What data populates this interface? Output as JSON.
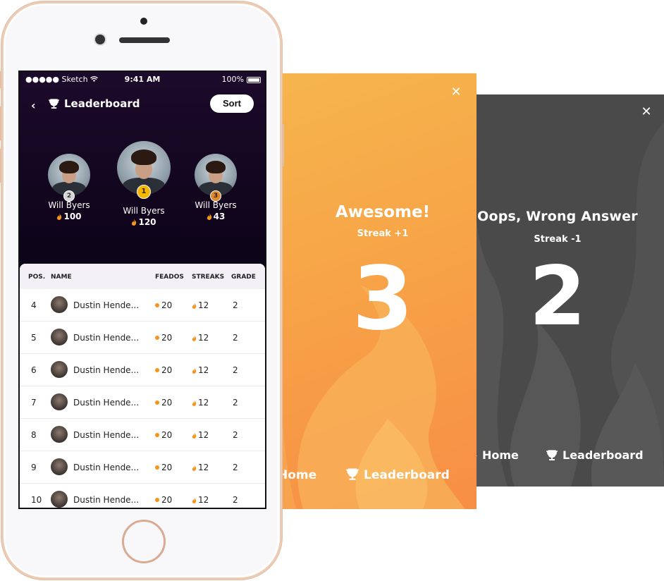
{
  "phone": {
    "status": {
      "carrier": "●●●●● Sketch",
      "time": "9:41 AM",
      "battery": "100%"
    },
    "header": {
      "title": "Leaderboard",
      "sort_label": "Sort"
    },
    "podium": [
      {
        "rank": "2",
        "name": "Will Byers",
        "score": "100",
        "badge_color": "#d6d6d6"
      },
      {
        "rank": "1",
        "name": "Will Byers",
        "score": "120",
        "badge_color": "#f5b800"
      },
      {
        "rank": "3",
        "name": "Will Byers",
        "score": "43",
        "badge_color": "#e08a2e"
      }
    ],
    "table": {
      "headers": {
        "pos": "POS.",
        "name": "NAME",
        "feados": "FEADOS",
        "streaks": "STREAKS",
        "grade": "GRADE"
      },
      "rows": [
        {
          "pos": "4",
          "name": "Dustin Hende...",
          "feados": "20",
          "streaks": "12",
          "grade": "2"
        },
        {
          "pos": "5",
          "name": "Dustin Hende...",
          "feados": "20",
          "streaks": "12",
          "grade": "2"
        },
        {
          "pos": "6",
          "name": "Dustin Hende...",
          "feados": "20",
          "streaks": "12",
          "grade": "2"
        },
        {
          "pos": "7",
          "name": "Dustin Hende...",
          "feados": "20",
          "streaks": "12",
          "grade": "2"
        },
        {
          "pos": "8",
          "name": "Dustin Hende...",
          "feados": "20",
          "streaks": "12",
          "grade": "2"
        },
        {
          "pos": "9",
          "name": "Dustin Hende...",
          "feados": "20",
          "streaks": "12",
          "grade": "2"
        },
        {
          "pos": "10",
          "name": "Dustin Hende...",
          "feados": "20",
          "streaks": "12",
          "grade": "2"
        }
      ]
    }
  },
  "correct_card": {
    "close_label": "✕",
    "title": "Awesome!",
    "subtitle": "Streak +1",
    "number": "3",
    "nav_home": "Home",
    "nav_leaderboard": "Leaderboard",
    "color": "#f7a247"
  },
  "wrong_card": {
    "close_label": "✕",
    "title": "Oops, Wrong Answer",
    "subtitle": "Streak -1",
    "number": "2",
    "nav_home": "Home",
    "nav_leaderboard": "Leaderboard",
    "color": "#4a4a4a"
  },
  "icons": {
    "back": "chevron-left-icon",
    "trophy": "trophy-icon",
    "flame": "flame-icon",
    "home": "home-icon",
    "close": "close-icon"
  },
  "accent": "#f7941d"
}
